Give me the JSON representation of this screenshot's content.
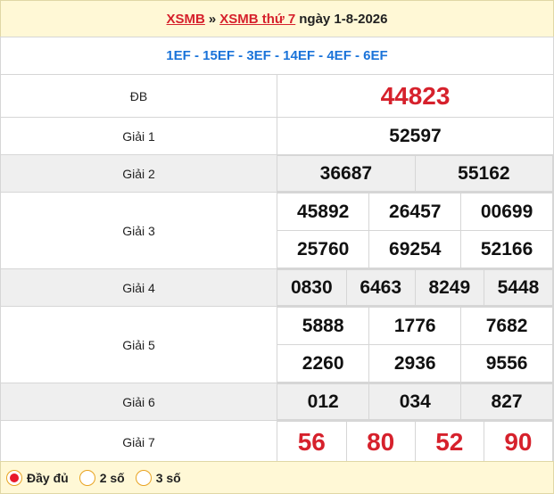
{
  "header": {
    "link1": "XSMB",
    "separator": "»",
    "link2": "XSMB thứ 7",
    "date_text": "ngày 1-8-2026"
  },
  "ma_db": "1EF - 15EF - 3EF - 14EF - 4EF - 6EF",
  "prizes": {
    "db": {
      "label": "ĐB",
      "numbers": [
        "44823"
      ]
    },
    "g1": {
      "label": "Giải 1",
      "numbers": [
        "52597"
      ]
    },
    "g2": {
      "label": "Giải 2",
      "numbers": [
        "36687",
        "55162"
      ]
    },
    "g3": {
      "label": "Giải 3",
      "numbers": [
        "45892",
        "26457",
        "00699",
        "25760",
        "69254",
        "52166"
      ]
    },
    "g4": {
      "label": "Giải 4",
      "numbers": [
        "0830",
        "6463",
        "8249",
        "5448"
      ]
    },
    "g5": {
      "label": "Giải 5",
      "numbers": [
        "5888",
        "1776",
        "7682",
        "2260",
        "2936",
        "9556"
      ]
    },
    "g6": {
      "label": "Giải 6",
      "numbers": [
        "012",
        "034",
        "827"
      ]
    },
    "g7": {
      "label": "Giải 7",
      "numbers": [
        "56",
        "80",
        "52",
        "90"
      ]
    }
  },
  "footer": {
    "options": [
      "Đầy đủ",
      "2 số",
      "3 số"
    ],
    "selected_index": 0
  },
  "colors": {
    "accent_red": "#d6212c",
    "code_blue": "#1a73d9",
    "header_bg": "#fff8d6",
    "gray_row": "#efefef"
  }
}
